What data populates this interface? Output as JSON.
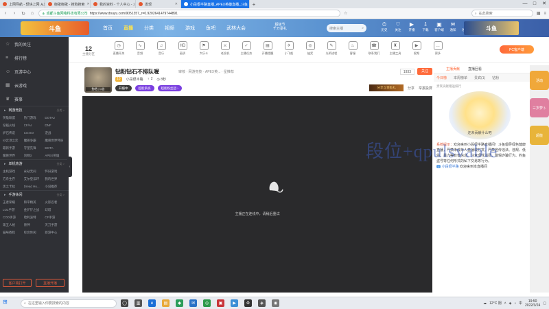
{
  "browser": {
    "tabs": [
      {
        "label": "上网导航 - 轻快上网 从这里开始",
        "active": false
      },
      {
        "label": "御歌御歌 - 搜狗搜索",
        "active": false
      },
      {
        "label": "我的资料 - 个人中心 - 斗鱼",
        "active": false
      },
      {
        "label": "发现",
        "active": false
      },
      {
        "label": "小段很半路直播_APEX英雄直播_斗鱼",
        "active": true
      }
    ],
    "new_tab": "+",
    "window_controls": [
      "—",
      "□",
      "✕"
    ],
    "address": {
      "site": "成都斗鱼网络科技有限公司",
      "url": "https://www.douyu.com/9051357_r=0.9202641479744891"
    },
    "search_placeholder": "在此搜索"
  },
  "site_nav": {
    "logo": "斗鱼",
    "links": [
      {
        "label": "首页",
        "active": false
      },
      {
        "label": "直播",
        "active": true
      },
      {
        "label": "分类",
        "active": false
      },
      {
        "label": "视频",
        "active": false
      },
      {
        "label": "游戏",
        "active": false
      },
      {
        "label": "鱼吧",
        "active": false
      },
      {
        "label": "武林大会",
        "active": false
      }
    ],
    "promo": "超级节\n千万豪礼",
    "search_placeholder": "搜索主播",
    "user_icons": [
      {
        "icon": "history-icon",
        "glyph": "⏱",
        "label": "历史"
      },
      {
        "icon": "follow-icon",
        "glyph": "♡",
        "label": "关注"
      },
      {
        "icon": "live-icon",
        "glyph": "▶",
        "label": "开播"
      },
      {
        "icon": "download-icon",
        "glyph": "⇩",
        "label": "下载"
      },
      {
        "icon": "client-icon",
        "glyph": "▣",
        "label": "客户端"
      },
      {
        "icon": "notice-icon",
        "glyph": "✉",
        "label": "通知"
      },
      {
        "icon": "gift-icon",
        "glyph": "★",
        "label": "领鱼翅"
      },
      {
        "icon": "user-icon",
        "glyph": "☺",
        "label": "我的"
      }
    ],
    "banner_right": "斗鱼"
  },
  "sidebar": {
    "main_items": [
      {
        "icon": "star-icon",
        "glyph": "☆",
        "label": "我的关注"
      },
      {
        "icon": "rank-icon",
        "glyph": "≡",
        "label": "排行榜"
      },
      {
        "icon": "user-icon",
        "glyph": "☺",
        "label": "页游中心"
      },
      {
        "icon": "game-icon",
        "glyph": "▦",
        "label": "云游戏"
      },
      {
        "icon": "trophy-icon",
        "glyph": "♛",
        "label": "赛事"
      }
    ],
    "sections": [
      {
        "title": "网游竞技",
        "more": "分类 >",
        "items": [
          "英雄联盟",
          "热门游戏",
          "DOTA2",
          "穿越火线",
          "CF/AI",
          "DNF",
          "炉石传说",
          "CS:GO",
          "逆战",
          "lol云顶之弈",
          "魔兽争霸",
          "魔兽世界怀旧",
          "最新手游",
          "守望先锋",
          "DOTA",
          "魔兽世界",
          "剑网3",
          "APEX英雄"
        ]
      },
      {
        "title": "单机热游",
        "more": "分类 >",
        "items": [
          "主机游戏",
          "永劫无间",
          "怀旧游戏",
          "方舟生存",
          "艾尔登法环",
          "我的世界",
          "黑之卡拉",
          "Dread Hu...",
          "小说推荐"
        ]
      },
      {
        "title": "手游休闲",
        "more": "分类 >",
        "items": [
          "王者荣耀",
          "和平精英",
          "火影忍者",
          "LOL手游",
          "金铲铲之战",
          "幻塔",
          "COD手游",
          "哈利波特",
          "CF手游",
          "第五人格",
          "原神",
          "天刀手游",
          "猫咪教程",
          "综合休闲",
          "新游中心"
        ]
      }
    ],
    "buttons": [
      "客户端打开",
      "直播开播"
    ],
    "collapse": "‹"
  },
  "category_bar": {
    "count": "12",
    "count_label": "主播分区",
    "items": [
      {
        "glyph": "◷",
        "label": "直播开关"
      },
      {
        "glyph": "∿",
        "label": "音频"
      },
      {
        "glyph": "♫",
        "label": "音乐"
      },
      {
        "glyph": "HD",
        "label": "画质"
      },
      {
        "glyph": "⚑",
        "label": "大乐斗"
      },
      {
        "glyph": "⚔",
        "label": "老虎机"
      },
      {
        "glyph": "✓",
        "label": "主播任务"
      },
      {
        "glyph": "▤",
        "label": "开播提醒"
      },
      {
        "glyph": "✈",
        "label": "小飞船"
      },
      {
        "glyph": "◎",
        "label": "抽奖"
      },
      {
        "glyph": "✎",
        "label": "光明进程"
      },
      {
        "glyph": "♨",
        "label": "客服"
      },
      {
        "glyph": "☎",
        "label": "联系我们"
      },
      {
        "glyph": "♜",
        "label": "主播工具"
      },
      {
        "glyph": "▶",
        "label": "视频"
      },
      {
        "glyph": "…",
        "label": "更多"
      }
    ],
    "pc_button": "PC客户端"
  },
  "room": {
    "title": "钻粉钻石不排队喔",
    "category": "审核 · 网游竞技 · APEX英... · 星推荐",
    "host": "小段很半路",
    "host_level": "10",
    "host_stats": [
      "♀ 2",
      "◷ 8秒"
    ],
    "avatar_caption": "鱼吧 | 公告",
    "badges": [
      {
        "label": "开播中",
        "color": "#3a3a3a"
      },
      {
        "label": "超能系统",
        "color": "#7a3fe0"
      },
      {
        "label": "超能粉丝团 ›",
        "color": "#7a3fe0"
      }
    ],
    "hot": "1933",
    "follow": "关注",
    "tools": [
      "分享",
      "举报投屏"
    ],
    "gift_banner": "分享立领鱼丸"
  },
  "player": {
    "message": "主播正在连线中，请稍后重试"
  },
  "chat": {
    "tabs": [
      {
        "label": "主播贡献",
        "active": true
      },
      {
        "label": "直播回看",
        "active": false
      }
    ],
    "rank_tabs": [
      {
        "label": "今日榜",
        "active": true
      },
      {
        "label": "本周榜单",
        "active": false
      },
      {
        "label": "贵宾(1)",
        "active": false
      },
      {
        "label": "钻粉",
        "active": false
      }
    ],
    "note": "贵宾贡献赠送排行",
    "art_caption": "还未贡献什么吧",
    "messages": [
      {
        "type": "sys",
        "prefix": "系统提示：",
        "text": "欢迎来到小段很半路直播间！斗鱼倡导绿色健康直播，严禁未成年人直播或打赏。严禁宣传违法、违规、低俗、暴力等有害信息。注意理性消费，警惕诈骗行为、钓鱼盗号等任何形式的私下交易等行为。"
      },
      {
        "type": "user",
        "level": "1",
        "name": "小段很半路",
        "text": "欢迎来到本直播间"
      }
    ],
    "partial_right": "钻石"
  },
  "right_strip": [
    {
      "label": "活动",
      "color": "#f0a83a"
    },
    {
      "label": "三岁萝卜",
      "color": "#e07fa0"
    },
    {
      "label": "超能",
      "color": "#e8b43a"
    }
  ],
  "watermark": "段位+qpulsvable",
  "taskbar": {
    "search_placeholder": "在这里输入你要搜索的内容",
    "apps": [
      {
        "glyph": "◯",
        "color": "#444"
      },
      {
        "glyph": "▥",
        "color": "#555"
      },
      {
        "glyph": "e",
        "color": "#1b6fd6"
      },
      {
        "glyph": "▤",
        "color": "#e8a93a"
      },
      {
        "glyph": "◆",
        "color": "#2a9d5a"
      },
      {
        "glyph": "✉",
        "color": "#2a72c6"
      },
      {
        "glyph": "◎",
        "color": "#2c9a4a"
      },
      {
        "glyph": "▣",
        "color": "#c8353a"
      },
      {
        "glyph": "▶",
        "color": "#3a8fd6"
      },
      {
        "glyph": "⚙",
        "color": "#333"
      },
      {
        "glyph": "◈",
        "color": "#555"
      },
      {
        "glyph": "◉",
        "color": "#777"
      }
    ],
    "weather": "12°C 阴",
    "time": "19:50",
    "date": "2022/3/24",
    "lang": "中"
  }
}
